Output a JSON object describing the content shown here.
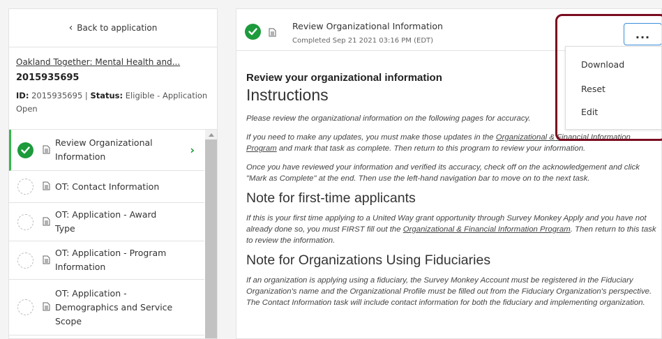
{
  "sidebar": {
    "back_label": "Back to application",
    "app_name": "Oakland Together: Mental Health and...",
    "app_number": "2015935695",
    "id_label": "ID:",
    "id_value": "2015935695",
    "status_label": "Status:",
    "status_value": "Eligible - Application Open",
    "tasks": [
      {
        "label": "Review Organizational Information",
        "status": "complete"
      },
      {
        "label": "OT: Contact Information",
        "status": "incomplete"
      },
      {
        "label": "OT: Application - Award Type",
        "status": "incomplete"
      },
      {
        "label": "OT: Application - Program Information",
        "status": "incomplete"
      },
      {
        "label": "OT: Application - Demographics and Service Scope",
        "status": "incomplete"
      }
    ]
  },
  "header": {
    "task_title": "Review Organizational Information",
    "completed": "Completed Sep 21 2021 03:16 PM (EDT)",
    "more_label": "..."
  },
  "menu": {
    "items": [
      "Download",
      "Reset",
      "Edit"
    ]
  },
  "content": {
    "subtitle": "Review your organizational information",
    "instructions_heading": "Instructions",
    "p1": "Please review the organizational information on the following pages for accuracy.",
    "p2_before": "If you need to make any updates, you must make those updates in the ",
    "p2_link": "Organizational & Financial Information Program",
    "p2_after": " and mark that task as complete.  Then return to this program to review your information.",
    "p3": "Once you have reviewed your information and verified its accuracy, check off on the acknowledgement and click \"Mark as Complete\" at the end.  Then use the left-hand navigation bar to move on to the next task.",
    "heading2": "Note for first-time applicants",
    "p4_before": "If this is your first time applying to a United Way grant opportunity through Survey Monkey Apply and you have not already done so, you must FIRST fill out the ",
    "p4_link": "Organizational & Financial Information Program",
    "p4_after": ".  Then return to this task to review the information.",
    "heading3": "Note for Organizations Using Fiduciaries",
    "p5": "If an organization is applying using a fiduciary, the Survey Monkey Account must be registered in the Fiduciary Organization's name and the Organizational Profile must be filled out from the Fiduciary Organization's perspective.  The Contact Information task will include contact information for both the fiduciary and implementing organization."
  },
  "colors": {
    "complete_green": "#1d9a3c",
    "active_bar": "#3ab64f",
    "button_border": "#3a8edb",
    "highlight": "#7a0c20"
  }
}
